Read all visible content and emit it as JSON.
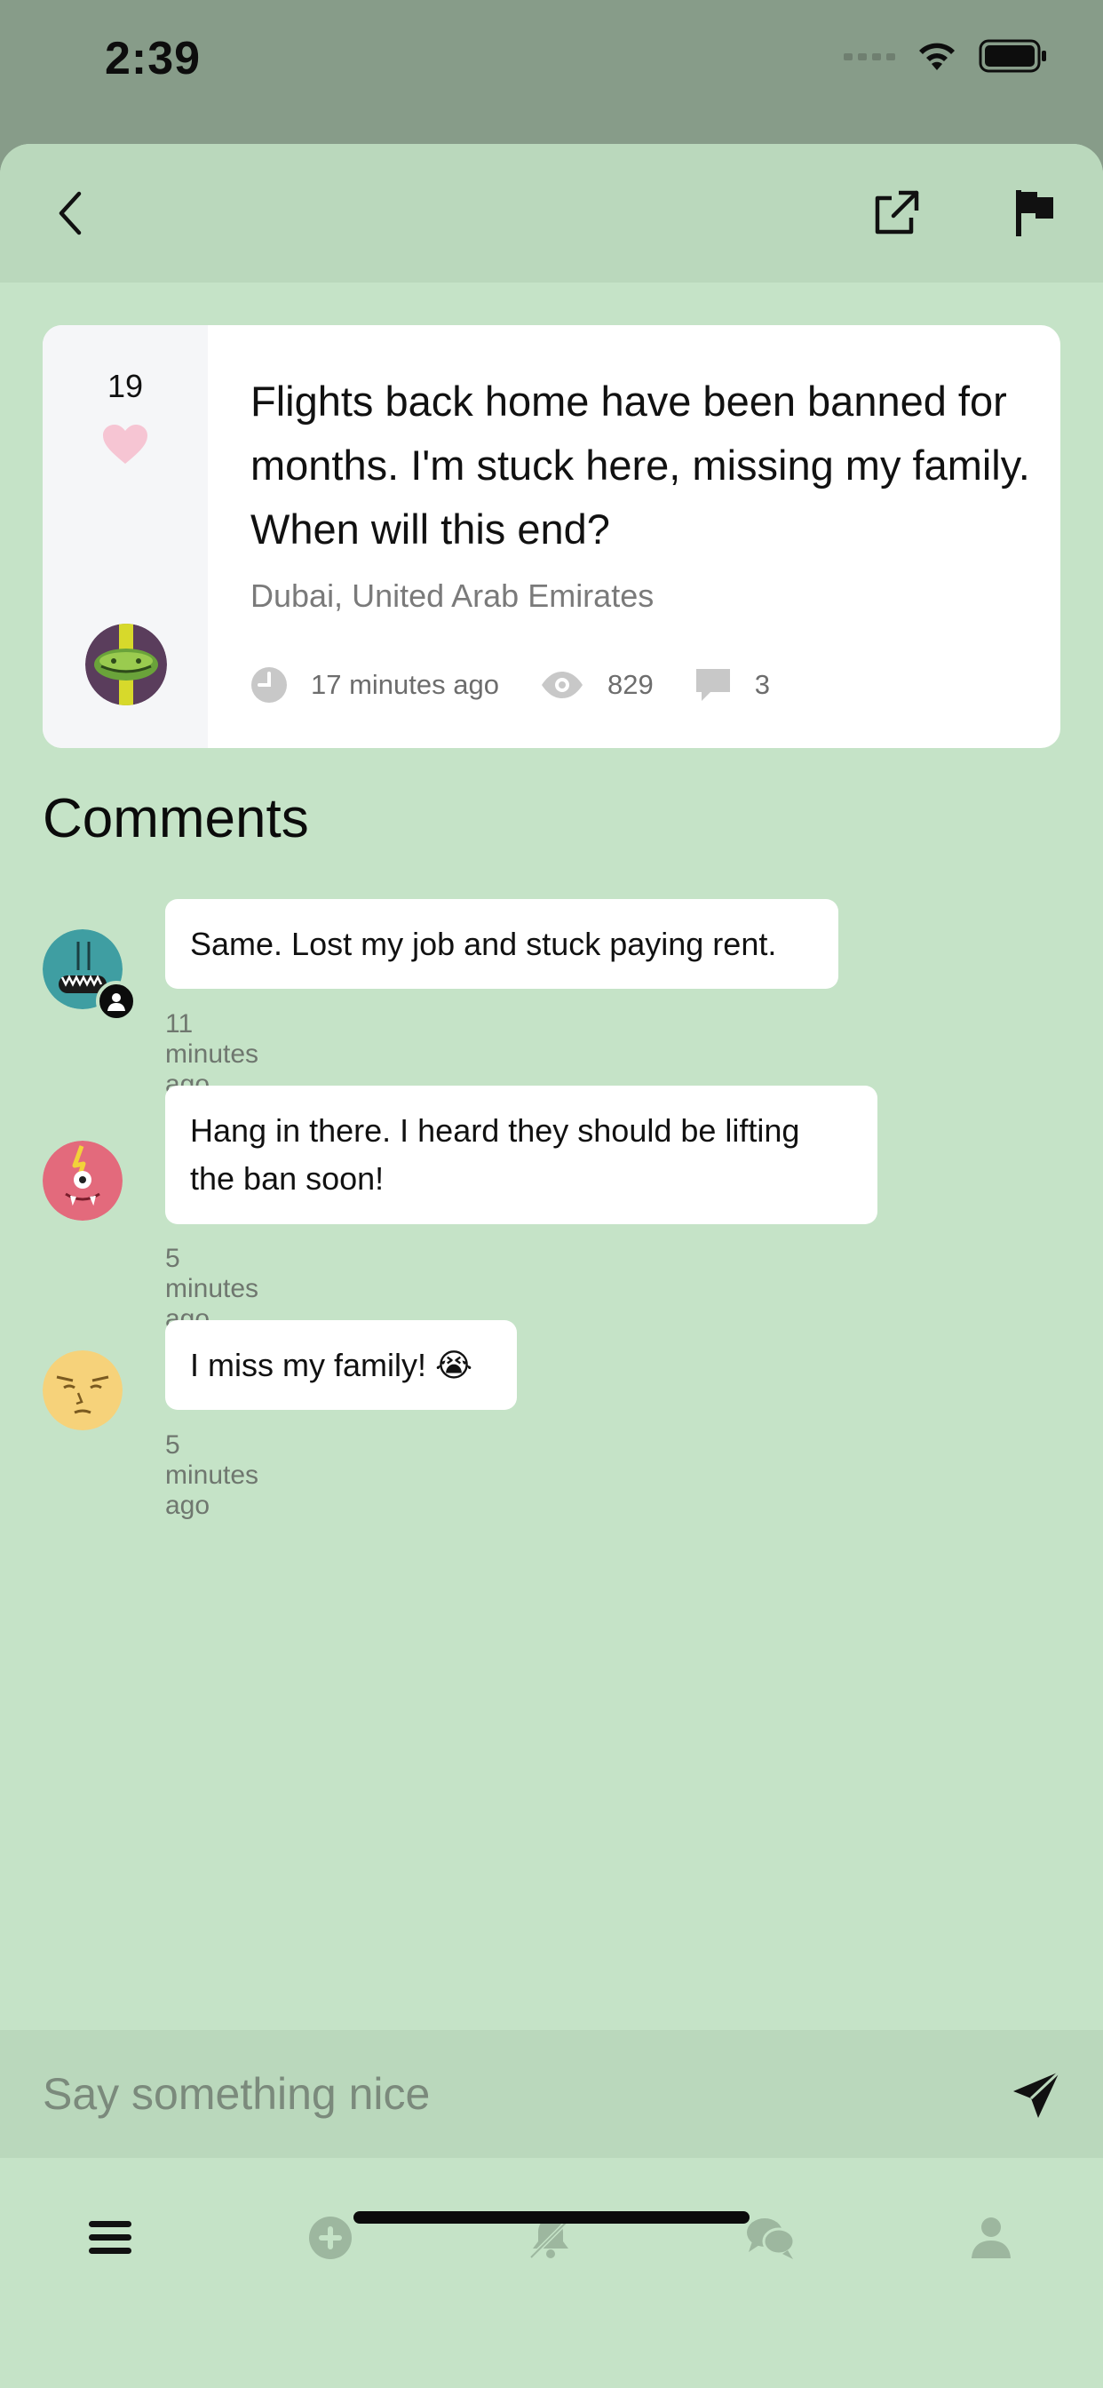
{
  "status_bar": {
    "time": "2:39"
  },
  "post": {
    "likes": "19",
    "text": "Flights back home have been banned for months. I'm stuck here, missing my family. When will this end?",
    "location": "Dubai, United Arab Emirates",
    "time_ago": "17 minutes ago",
    "views": "829",
    "comment_count": "3"
  },
  "comments_section": {
    "title": "Comments",
    "items": [
      {
        "text": "Same. Lost my job and stuck paying rent.",
        "time": "11 minutes ago"
      },
      {
        "text": "Hang in there. I heard they should be lifting the ban soon!",
        "time": "5 minutes ago"
      },
      {
        "text": "I miss my family! 😭",
        "time": "5 minutes ago"
      }
    ]
  },
  "composer": {
    "placeholder": "Say something nice"
  },
  "colors": {
    "sheet_bg": "#c5e3c7",
    "nav_bg": "#bad8bc",
    "status_bg": "#879c89",
    "heart": "#f6c5d3",
    "icon_grey": "#c3c3c3",
    "tab_inactive": "#9db79f"
  },
  "icons": {
    "back": "chevron-left-icon",
    "share": "external-link-icon",
    "report": "flag-icon",
    "like": "heart-icon",
    "time": "clock-icon",
    "views": "eye-icon",
    "comments": "speech-bubble-icon",
    "send": "paper-plane-icon",
    "tabs": [
      "menu-icon",
      "add-circle-icon",
      "bell-off-icon",
      "chat-bubbles-icon",
      "person-icon"
    ]
  }
}
